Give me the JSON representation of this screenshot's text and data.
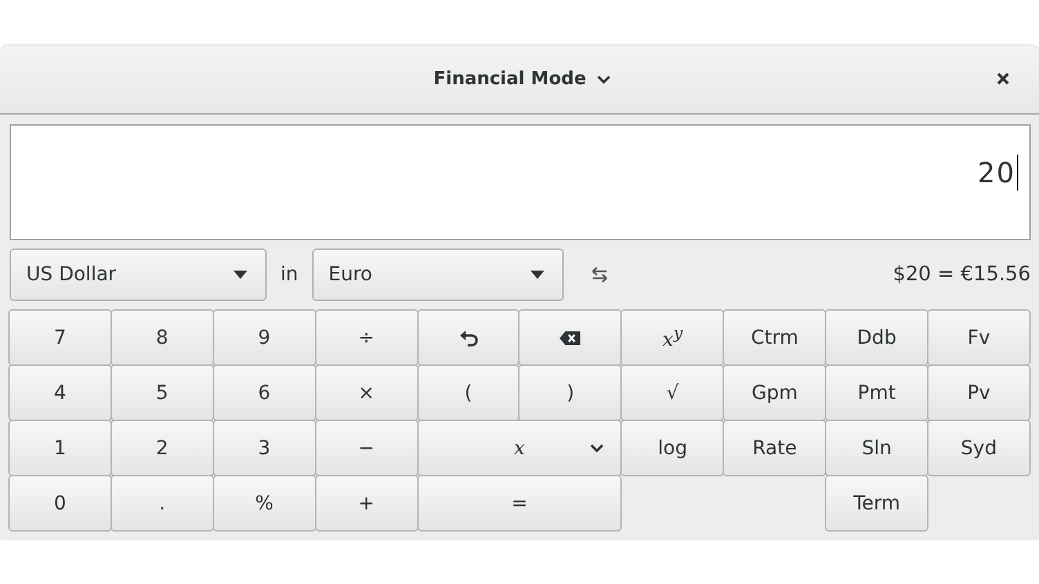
{
  "window": {
    "title": "Financial Mode"
  },
  "display": {
    "value": "20"
  },
  "conversion": {
    "from": "US Dollar",
    "in_label": "in",
    "to": "Euro",
    "result": "$20 = €15.56"
  },
  "keypad": [
    [
      {
        "label": "7"
      },
      {
        "label": "8"
      },
      {
        "label": "9"
      },
      {
        "label": "÷"
      },
      {
        "kind": "undo"
      },
      {
        "kind": "backspace"
      },
      {
        "label": "x$^{y}$",
        "italic": true
      },
      {
        "label": "Ctrm"
      },
      {
        "label": "Ddb"
      },
      {
        "label": "Fv"
      }
    ],
    [
      {
        "label": "4"
      },
      {
        "label": "5"
      },
      {
        "label": "6"
      },
      {
        "label": "×"
      },
      {
        "label": "("
      },
      {
        "label": ")"
      },
      {
        "label": "√"
      },
      {
        "label": "Gpm"
      },
      {
        "label": "Pmt"
      },
      {
        "label": "Pv"
      }
    ],
    [
      {
        "label": "1"
      },
      {
        "label": "2"
      },
      {
        "label": "3"
      },
      {
        "label": "−"
      },
      {
        "label": "x",
        "italic": true,
        "wide": true,
        "menu": true
      },
      {
        "label": "log"
      },
      {
        "label": "Rate"
      },
      {
        "label": "Sln"
      },
      {
        "label": "Syd"
      }
    ],
    [
      {
        "label": "0"
      },
      {
        "label": "."
      },
      {
        "label": "%"
      },
      {
        "label": "+"
      },
      {
        "label": "=",
        "wide": true
      },
      {
        "label": "Term"
      }
    ]
  ]
}
